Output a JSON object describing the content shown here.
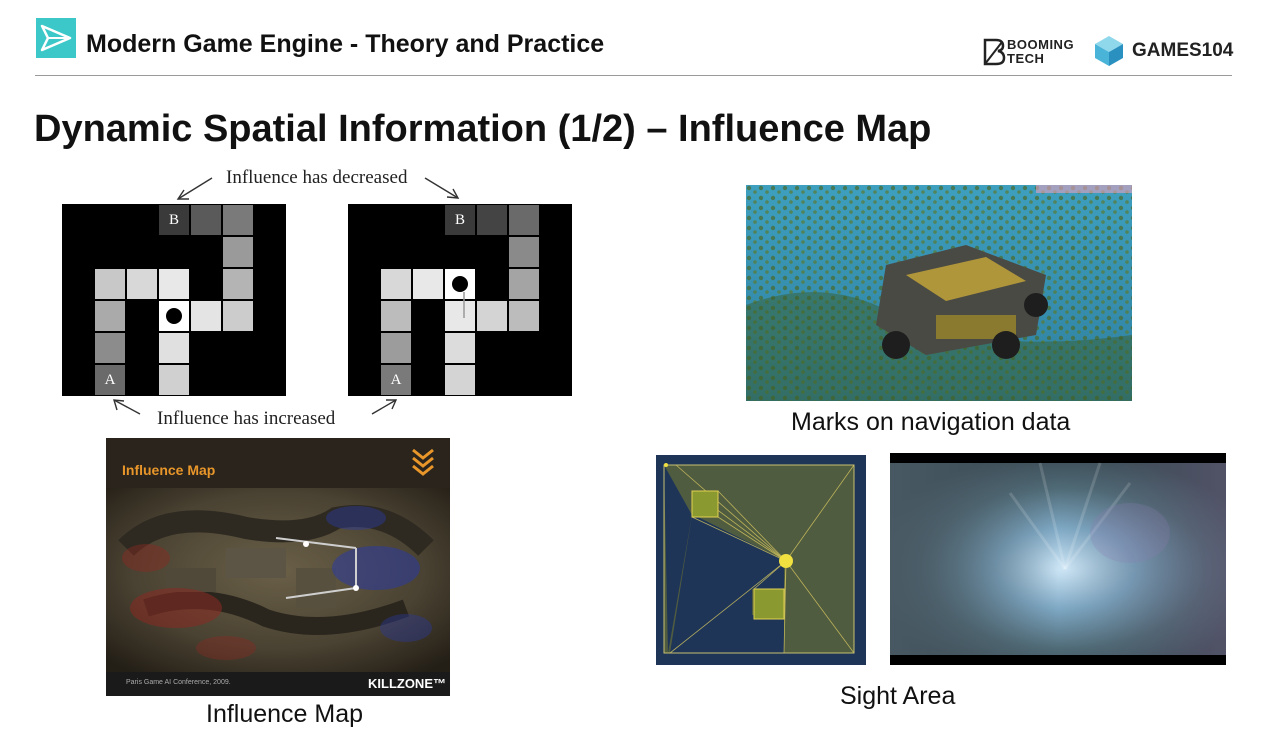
{
  "header": {
    "course_title": "Modern Game Engine - Theory and Practice",
    "brand_booming_line1": "BOOMING",
    "brand_booming_line2": "TECH",
    "brand_games": "GAMES104"
  },
  "slide": {
    "title": "Dynamic Spatial Information (1/2) – Influence Map"
  },
  "diagram": {
    "label_top": "Influence has decreased",
    "label_bottom": "Influence has increased",
    "cell_b": "B",
    "cell_a": "A"
  },
  "killzone": {
    "header_title": "Influence Map",
    "footer_credit": "Paris Game AI Conference, 2009.",
    "footer_brand": "KILLZONE™"
  },
  "captions": {
    "influence_map": "Influence Map",
    "navigation": "Marks on navigation data",
    "sight_area": "Sight Area"
  },
  "colors": {
    "accent": "#3cc8c8",
    "killzone_orange": "#e8962a",
    "sight_yellow": "#f0e040",
    "sight_bg": "#1e3558"
  }
}
